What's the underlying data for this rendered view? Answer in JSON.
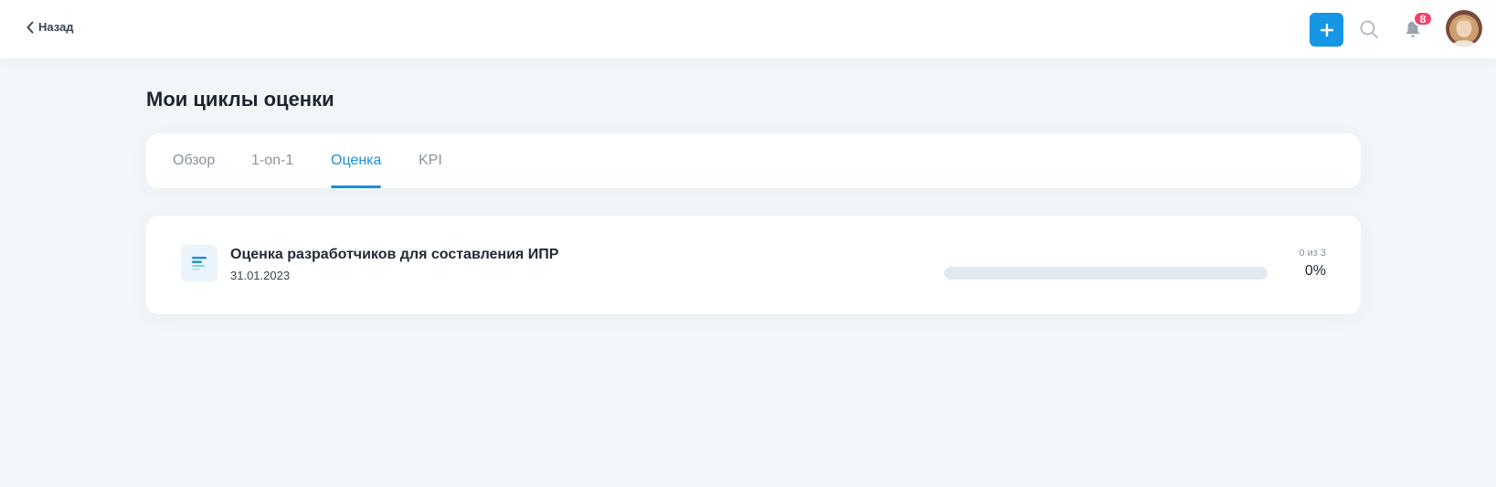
{
  "header": {
    "back_label": "Назад",
    "notifications_count": "8",
    "accent_color": "#1597e5",
    "badge_color": "#f0436b",
    "icons": [
      "chevron-left-icon",
      "plus-icon",
      "search-icon",
      "bell-icon",
      "avatar"
    ]
  },
  "page": {
    "title": "Мои циклы оценки"
  },
  "tabs": [
    {
      "label": "Обзор",
      "active": false
    },
    {
      "label": "1-on-1",
      "active": false
    },
    {
      "label": "Оценка",
      "active": true
    },
    {
      "label": "KPI",
      "active": false
    }
  ],
  "cycles": [
    {
      "title": "Оценка разработчиков для составления ИПР",
      "date": "31.01.2023",
      "progress_count": "0 из 3",
      "progress_percent": "0%",
      "progress_fraction": 0,
      "icon": "document-lines-icon"
    }
  ]
}
